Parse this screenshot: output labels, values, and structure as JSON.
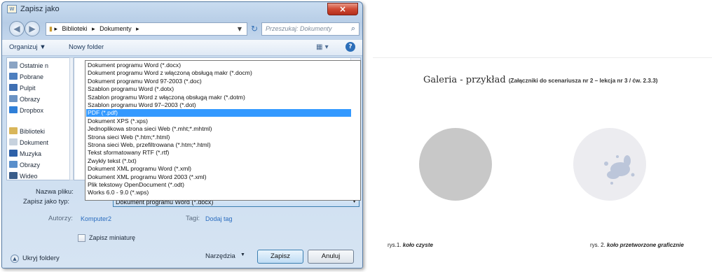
{
  "dialog": {
    "title": "Zapisz jako",
    "close_glyph": "×",
    "breadcrumbs": [
      "Biblioteki",
      "Dokumenty"
    ],
    "search_placeholder": "Przeszukaj: Dokumenty",
    "toolbar": {
      "organize": "Organizuj ▼",
      "new_folder": "Nowy folder"
    },
    "nav_items": [
      {
        "label": "Ostatnie n",
        "icon": "recent-places-icon",
        "color": "#8aa4c4"
      },
      {
        "label": "Pobrane",
        "icon": "downloads-folder-icon",
        "color": "#4d7fbf"
      },
      {
        "label": "Pulpit",
        "icon": "desktop-icon",
        "color": "#3f6fb2"
      },
      {
        "label": "Obrazy",
        "icon": "pictures-folder-icon",
        "color": "#6b93c4"
      },
      {
        "label": "Dropbox",
        "icon": "dropbox-icon",
        "color": "#2f7fd8"
      },
      {
        "label": "Biblioteki",
        "icon": "libraries-icon",
        "color": "#d9b65a"
      },
      {
        "label": "Dokument",
        "icon": "documents-library-icon",
        "color": "#c7d2de"
      },
      {
        "label": "Muzyka",
        "icon": "music-library-icon",
        "color": "#2e61a8"
      },
      {
        "label": "Obrazy",
        "icon": "pictures-library-icon",
        "color": "#5a8fcb"
      },
      {
        "label": "Wideo",
        "icon": "video-library-icon",
        "color": "#3a5d8a"
      }
    ],
    "file_types": [
      "Dokument programu Word (*.docx)",
      "Dokument programu Word z włączoną obsługą makr (*.docm)",
      "Dokument programu Word 97-2003 (*.doc)",
      "Szablon programu Word (*.dotx)",
      "Szablon programu Word z włączoną obsługą makr (*.dotm)",
      "Szablon programu Word 97–2003 (*.dot)",
      "PDF (*.pdf)",
      "Dokument XPS (*.xps)",
      "Jednoplikowa strona sieci Web (*.mht;*.mhtml)",
      "Strona sieci Web (*.htm;*.html)",
      "Strona sieci Web, przefiltrowana (*.htm;*.html)",
      "Tekst sformatowany RTF (*.rtf)",
      "Zwykły tekst (*.txt)",
      "Dokument XML programu Word (*.xml)",
      "Dokument XML programu Word 2003 (*.xml)",
      "Plik tekstowy OpenDocument (*.odt)",
      "Works 6.0 - 9.0 (*.wps)"
    ],
    "selected_index": 6,
    "filename_label": "Nazwa pliku:",
    "type_label": "Zapisz jako typ:",
    "type_value": "Dokument programu Word (*.docx)",
    "authors_label": "Autorzy:",
    "authors_value": "Komputer2",
    "tags_label": "Tagi:",
    "tags_value": "Dodaj tag",
    "thumbnail_label": "Zapisz miniaturę",
    "hide_folders": "Ukryj foldery",
    "tools": "Narzędzia",
    "save": "Zapisz",
    "cancel": "Anuluj"
  },
  "document": {
    "title": "Galeria -  przykład",
    "subtitle": "(Załączniki do scenariusza nr 2 – lekcja nr 3 / ćw. 2.3.3)",
    "fig1_prefix": "rys.1.",
    "fig1_name": "koło czyste",
    "fig2_prefix": "rys. 2.",
    "fig2_name": "koło przetworzone graficznie",
    "circle_color": "#c8c8c8",
    "circle2_color": "#ececf0",
    "splash_color": "#bcc6da"
  }
}
